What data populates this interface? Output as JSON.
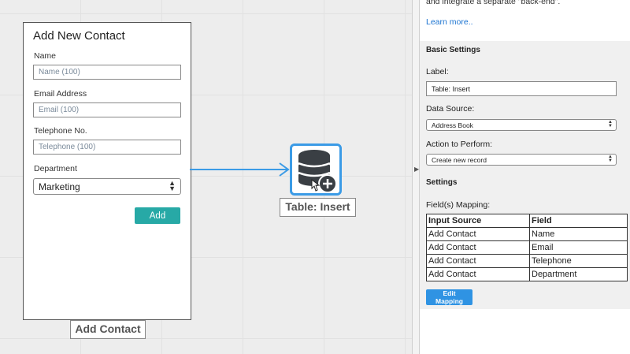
{
  "form_node": {
    "title": "Add New Contact",
    "fields": [
      {
        "label": "Name",
        "placeholder": "Name (100)"
      },
      {
        "label": "Email Address",
        "placeholder": "Email (100)"
      },
      {
        "label": "Telephone No.",
        "placeholder": "Telephone (100)"
      }
    ],
    "department": {
      "label": "Department",
      "value": "Marketing"
    },
    "add_button": "Add",
    "caption": "Add Contact"
  },
  "table_node": {
    "caption": "Table: Insert",
    "icon": "database-plus-icon",
    "accent": "#3b9be6"
  },
  "panel": {
    "intro_text": "and integrate a separate \"back-end\".",
    "learn_more": "Learn more..",
    "basic_settings_title": "Basic Settings",
    "label_label": "Label:",
    "label_value": "Table: Insert",
    "data_source_label": "Data Source:",
    "data_source_value": "Address Book",
    "action_label": "Action to Perform:",
    "action_value": "Create new record",
    "settings_title": "Settings",
    "mapping_label": "Field(s) Mapping:",
    "mapping": {
      "headers": [
        "Input Source",
        "Field"
      ],
      "rows": [
        [
          "Add Contact",
          "Name"
        ],
        [
          "Add Contact",
          "Email"
        ],
        [
          "Add Contact",
          "Telephone"
        ],
        [
          "Add Contact",
          "Department"
        ]
      ]
    },
    "edit_mapping_button": "Edit Mapping"
  },
  "colors": {
    "add_button": "#27a9a6",
    "edit_button": "#2f93e3",
    "link": "#1a73d1"
  }
}
